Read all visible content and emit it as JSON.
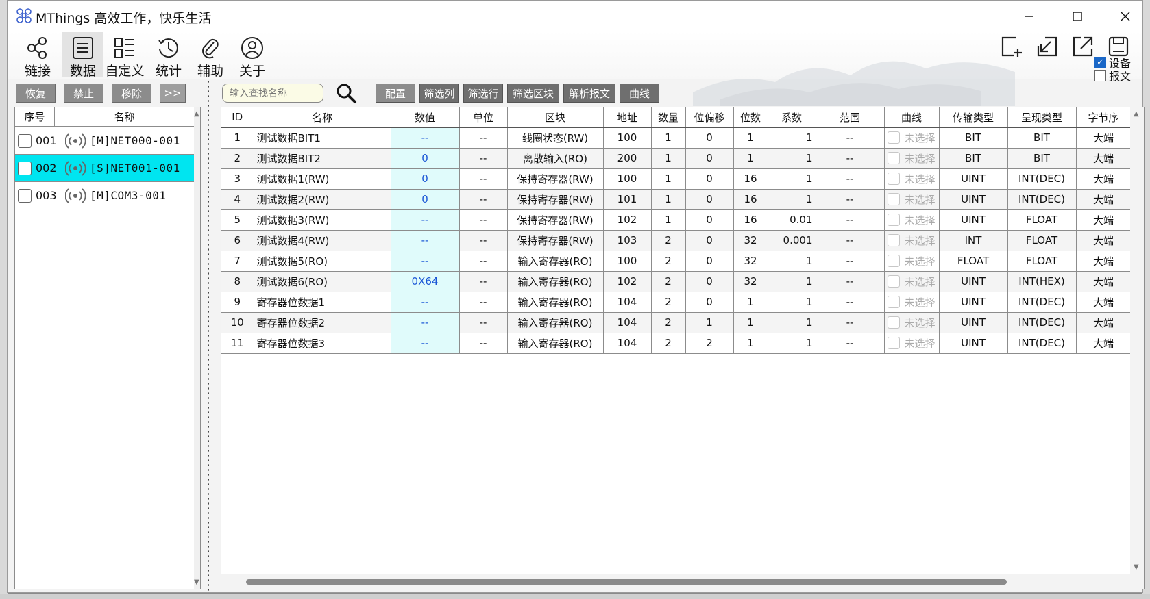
{
  "app": {
    "title": "MThings 高效工作，快乐生活"
  },
  "toolbar": {
    "items": [
      {
        "label": "链接"
      },
      {
        "label": "数据"
      },
      {
        "label": "自定义"
      },
      {
        "label": "统计"
      },
      {
        "label": "辅助"
      },
      {
        "label": "关于"
      }
    ],
    "active_index": 1,
    "checks": [
      {
        "label": "设备",
        "checked": true
      },
      {
        "label": "报文",
        "checked": false
      }
    ]
  },
  "device_buttons": {
    "restore": "恢复",
    "disable": "禁止",
    "remove": "移除",
    "expand": ">>"
  },
  "device_list": {
    "headers": {
      "num": "序号",
      "name": "名称"
    },
    "rows": [
      {
        "num": "001",
        "name": "[M]NET000-001",
        "selected": false
      },
      {
        "num": "002",
        "name": "[S]NET001-001",
        "selected": true
      },
      {
        "num": "003",
        "name": "[M]COM3-001",
        "selected": false
      }
    ]
  },
  "search": {
    "placeholder": "输入查找名称"
  },
  "filter_buttons": {
    "config": "配置",
    "filter_col": "筛选列",
    "filter_row": "筛选行",
    "filter_block": "筛选区块",
    "parse_msg": "解析报文",
    "curve": "曲线"
  },
  "data_table": {
    "headers": [
      "ID",
      "名称",
      "数值",
      "单位",
      "区块",
      "地址",
      "数量",
      "位偏移",
      "位数",
      "系数",
      "范围",
      "曲线",
      "传输类型",
      "呈现类型",
      "字节序"
    ],
    "curve_text": "未选择",
    "rows": [
      [
        "1",
        "测试数据BIT1",
        "--",
        "--",
        "线圈状态(RW)",
        "100",
        "1",
        "0",
        "1",
        "1",
        "--",
        "未选择",
        "BIT",
        "BIT",
        "大端"
      ],
      [
        "2",
        "测试数据BIT2",
        "0",
        "--",
        "离散输入(RO)",
        "200",
        "1",
        "0",
        "1",
        "1",
        "--",
        "未选择",
        "BIT",
        "BIT",
        "大端"
      ],
      [
        "3",
        "测试数据1(RW)",
        "0",
        "--",
        "保持寄存器(RW)",
        "100",
        "1",
        "0",
        "16",
        "1",
        "--",
        "未选择",
        "UINT",
        "INT(DEC)",
        "大端"
      ],
      [
        "4",
        "测试数据2(RW)",
        "0",
        "--",
        "保持寄存器(RW)",
        "101",
        "1",
        "0",
        "16",
        "1",
        "--",
        "未选择",
        "UINT",
        "INT(DEC)",
        "大端"
      ],
      [
        "5",
        "测试数据3(RW)",
        "--",
        "--",
        "保持寄存器(RW)",
        "102",
        "1",
        "0",
        "16",
        "0.01",
        "--",
        "未选择",
        "UINT",
        "FLOAT",
        "大端"
      ],
      [
        "6",
        "测试数据4(RW)",
        "--",
        "--",
        "保持寄存器(RW)",
        "103",
        "2",
        "0",
        "32",
        "0.001",
        "--",
        "未选择",
        "INT",
        "FLOAT",
        "大端"
      ],
      [
        "7",
        "测试数据5(RO)",
        "--",
        "--",
        "输入寄存器(RO)",
        "100",
        "2",
        "0",
        "32",
        "1",
        "--",
        "未选择",
        "FLOAT",
        "FLOAT",
        "大端"
      ],
      [
        "8",
        "测试数据6(RO)",
        "0X64",
        "--",
        "输入寄存器(RO)",
        "102",
        "2",
        "0",
        "32",
        "1",
        "--",
        "未选择",
        "UINT",
        "INT(HEX)",
        "大端"
      ],
      [
        "9",
        "寄存器位数据1",
        "--",
        "--",
        "输入寄存器(RO)",
        "104",
        "2",
        "0",
        "1",
        "1",
        "--",
        "未选择",
        "UINT",
        "INT(DEC)",
        "大端"
      ],
      [
        "10",
        "寄存器位数据2",
        "--",
        "--",
        "输入寄存器(RO)",
        "104",
        "2",
        "1",
        "1",
        "1",
        "--",
        "未选择",
        "UINT",
        "INT(DEC)",
        "大端"
      ],
      [
        "11",
        "寄存器位数据3",
        "--",
        "--",
        "输入寄存器(RO)",
        "104",
        "2",
        "2",
        "1",
        "1",
        "--",
        "未选择",
        "UINT",
        "INT(DEC)",
        "大端"
      ]
    ]
  },
  "colors": {
    "selected_row": "#00e5f0",
    "value_cell": "#e0fbfb",
    "value_text": "#1a56d6"
  }
}
